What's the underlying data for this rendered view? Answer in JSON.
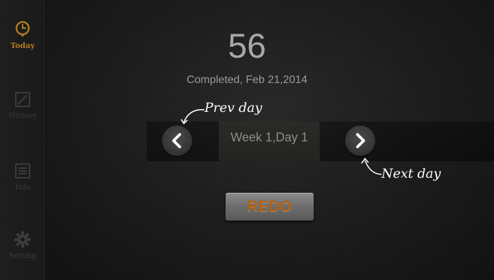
{
  "sidebar": {
    "items": [
      {
        "label": "Today",
        "icon": "clock-icon",
        "active": true
      },
      {
        "label": "History",
        "icon": "history-icon",
        "active": false
      },
      {
        "label": "Info",
        "icon": "info-icon",
        "active": false
      },
      {
        "label": "Setting",
        "icon": "gear-icon",
        "active": false
      }
    ]
  },
  "main": {
    "count": "56",
    "status": "Completed, Feb 21,2014",
    "day_label": "Week 1,Day 1",
    "prev_annotation": "Prev day",
    "next_annotation": "Next day",
    "redo_label": "REDO"
  },
  "colors": {
    "accent": "#b07d1f",
    "redo_text": "#b3600f",
    "background": "#1c1c1c"
  }
}
